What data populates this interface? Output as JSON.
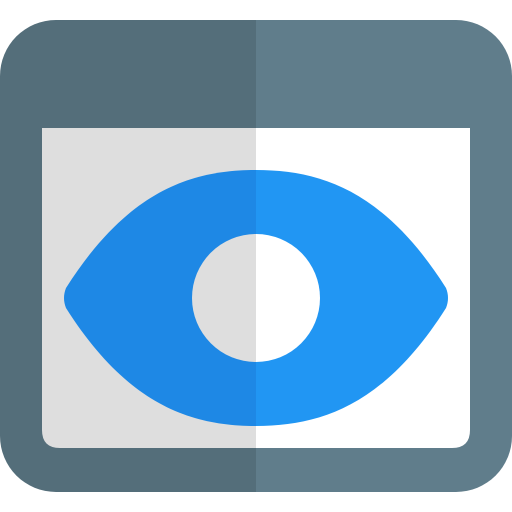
{
  "icon": {
    "name": "browser-eye-icon",
    "colors": {
      "frame_left": "#546E7A",
      "frame_right": "#607D8B",
      "screen_left": "#DEDEDE",
      "screen_right": "#FFFFFF",
      "eye_left": "#1E88E5",
      "eye_right": "#2196F3",
      "pupil_left": "#DEDEDE",
      "pupil_right": "#FFFFFF"
    }
  }
}
